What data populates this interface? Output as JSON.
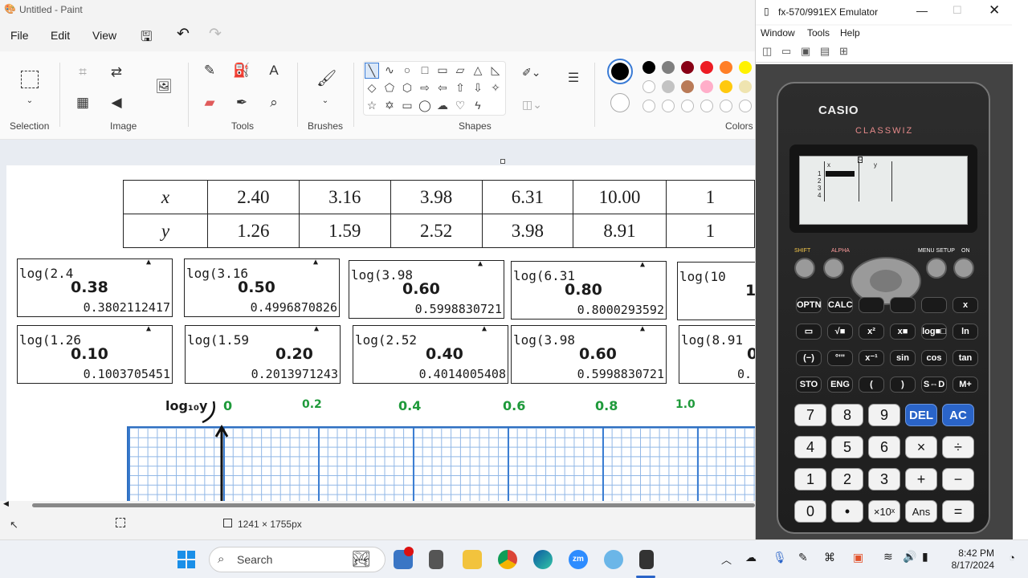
{
  "paint": {
    "title": "Untitled - Paint",
    "menu": [
      "File",
      "Edit",
      "View"
    ],
    "groups": {
      "selection": "Selection",
      "image": "Image",
      "tools": "Tools",
      "brushes": "Brushes",
      "shapes": "Shapes",
      "colors": "Colors"
    },
    "colors": {
      "row1": [
        "#000000",
        "#7f7f7f",
        "#880015",
        "#ed1c24",
        "#ff7f27",
        "#fff200"
      ],
      "row2": [
        "#ffffff",
        "#c3c3c3",
        "#b97a57",
        "#ffaec9",
        "#ffc90e",
        "#efe4b0"
      ]
    },
    "status": {
      "canvas_size": "1241 × 1755px"
    },
    "table": {
      "x_label": "x",
      "y_label": "y",
      "x_values": [
        "2.40",
        "3.16",
        "3.98",
        "6.31",
        "10.00",
        "1"
      ],
      "y_values": [
        "1.26",
        "1.59",
        "2.52",
        "3.98",
        "8.91",
        "1"
      ]
    },
    "calc_boxes_row1": [
      {
        "expr": "log(2.4",
        "hw": "0.38",
        "res": "0.3802112417"
      },
      {
        "expr": "log(3.16",
        "hw": "0.50",
        "res": "0.4996870826"
      },
      {
        "expr": "log(3.98",
        "hw": "0.60",
        "res": "0.5998830721"
      },
      {
        "expr": "log(6.31",
        "hw": "0.80",
        "res": "0.8000293592"
      },
      {
        "expr": "log(10",
        "hw": "1.",
        "res": ""
      }
    ],
    "calc_boxes_row2": [
      {
        "expr": "log(1.26",
        "hw": "0.10",
        "res": "0.1003705451"
      },
      {
        "expr": "log(1.59",
        "hw": "0.20",
        "res": "0.2013971243"
      },
      {
        "expr": "log(2.52",
        "hw": "0.40",
        "res": "0.4014005408"
      },
      {
        "expr": "log(3.98",
        "hw": "0.60",
        "res": "0.5998830721"
      },
      {
        "expr": "log(8.91",
        "hw": "0.",
        "res": "0."
      }
    ],
    "graph": {
      "axis_label": "log₁₀y",
      "ticks": [
        "0",
        "0.2",
        "0.4",
        "0.6",
        "0.8",
        "1.0"
      ]
    }
  },
  "emulator": {
    "title": "fx-570/991EX Emulator",
    "menu": [
      "Window",
      "Tools",
      "Help"
    ],
    "brand": "CASIO",
    "model": "CLASSWIZ",
    "lcd": {
      "col_x": "x",
      "col_y": "y",
      "rows": [
        "1",
        "2",
        "3",
        "4"
      ]
    },
    "keys": {
      "shift": "SHIFT",
      "alpha": "ALPHA",
      "menu": "MENU SETUP",
      "on": "ON",
      "r1": [
        "OPTN",
        "CALC",
        "",
        "",
        "",
        "x"
      ],
      "r2": [
        "▭",
        "√■",
        "x²",
        "x■",
        "log■□",
        "ln"
      ],
      "r3": [
        "(−)",
        "°'\"",
        "x⁻¹",
        "sin",
        "cos",
        "tan"
      ],
      "r4": [
        "STO",
        "ENG",
        "(",
        ")",
        "S⇔D",
        "M+"
      ],
      "num": [
        [
          "7",
          "8",
          "9",
          "DEL",
          "AC"
        ],
        [
          "4",
          "5",
          "6",
          "×",
          "÷"
        ],
        [
          "1",
          "2",
          "3",
          "+",
          "−"
        ],
        [
          "0",
          "•",
          "×10ˣ",
          "Ans",
          "="
        ]
      ]
    }
  },
  "taskbar": {
    "search": "Search",
    "time": "8:42 PM",
    "date": "8/17/2024"
  }
}
